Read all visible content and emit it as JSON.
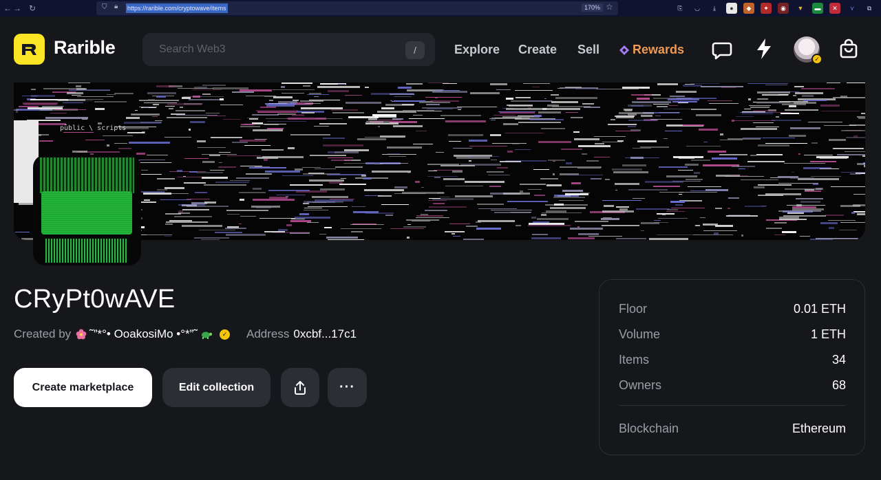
{
  "browser": {
    "url": "https://rarible.com/cryptowave/items",
    "zoom": "170%"
  },
  "header": {
    "logo_text": "Rarible",
    "search_placeholder": "Search Web3",
    "search_shortcut": "/",
    "nav": {
      "explore": "Explore",
      "create": "Create",
      "sell": "Sell",
      "rewards": "Rewards"
    },
    "rewards_color": "#ee9a54",
    "logo_color": "#fbe424"
  },
  "banner": {
    "path_text": "public \\ scripts"
  },
  "collection": {
    "title": "CRyPt0wAVE",
    "created_by_label": "Created by",
    "creator_name": "˜”*°• OoakosiMo •°*”˜",
    "address_label": "Address",
    "address": "0xcbf...17c1"
  },
  "actions": {
    "create_marketplace": "Create marketplace",
    "edit_collection": "Edit collection",
    "more": "···"
  },
  "stats": {
    "floor_label": "Floor",
    "floor_value": "0.01 ETH",
    "volume_label": "Volume",
    "volume_value": "1 ETH",
    "items_label": "Items",
    "items_value": "34",
    "owners_label": "Owners",
    "owners_value": "68",
    "blockchain_label": "Blockchain",
    "blockchain_value": "Ethereum"
  }
}
